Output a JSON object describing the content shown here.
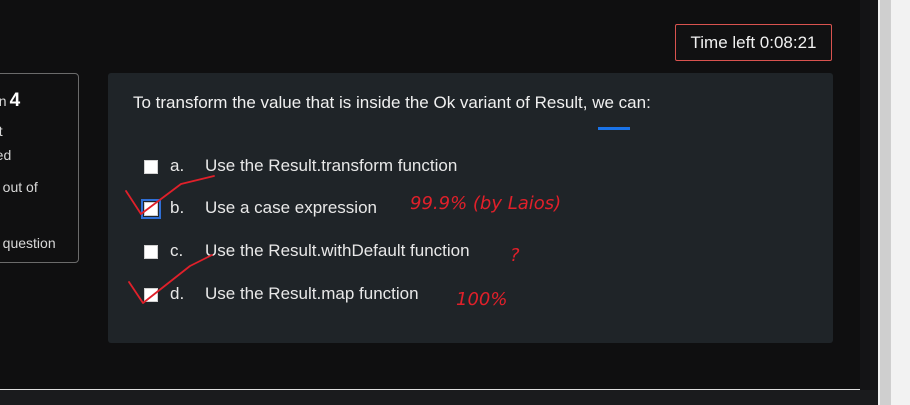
{
  "timer": {
    "label": "Time left 0:08:21"
  },
  "question_info": {
    "lines": [
      "on",
      "et",
      "red",
      "d out of",
      "g question"
    ],
    "number": "4"
  },
  "question": {
    "text": "To transform the value that is inside the Ok variant of Result, we can:",
    "options": [
      {
        "letter": "a.",
        "text": "Use the Result.transform function",
        "checked": false
      },
      {
        "letter": "b.",
        "text": "Use a case expression",
        "checked": false,
        "focused": true
      },
      {
        "letter": "c.",
        "text": "Use the Result.withDefault function",
        "checked": false
      },
      {
        "letter": "d.",
        "text": "Use the Result.map function",
        "checked": false
      }
    ]
  },
  "handwritten_notes": {
    "note_b": "99.9% (by Laios)",
    "note_c": "?",
    "note_d": "100%",
    "color": "#e0202a"
  },
  "colors": {
    "background": "#0f0f10",
    "card": "#1f2428",
    "timer_border": "#d9534f",
    "focus_blue": "#2f6fd6"
  }
}
